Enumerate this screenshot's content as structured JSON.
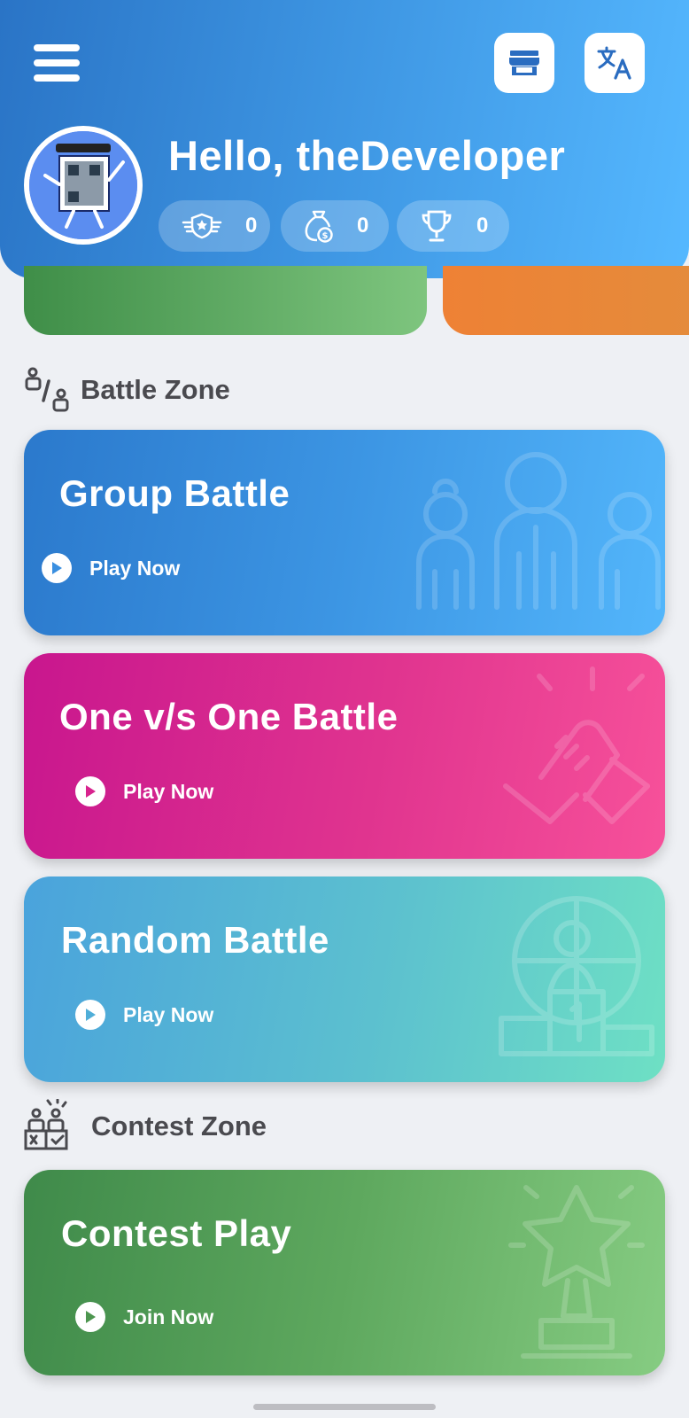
{
  "header": {
    "greeting": "Hello, theDeveloper",
    "stats": [
      {
        "icon": "rank-badge-icon",
        "value": "0"
      },
      {
        "icon": "coin-bag-icon",
        "value": "0"
      },
      {
        "icon": "trophy-icon",
        "value": "0"
      }
    ]
  },
  "battle_zone": {
    "title": "Battle Zone",
    "cards": [
      {
        "title": "Group Battle",
        "action": "Play Now"
      },
      {
        "title": "One v/s One Battle",
        "action": "Play Now"
      },
      {
        "title": "Random Battle",
        "action": "Play Now"
      }
    ]
  },
  "contest_zone": {
    "title": "Contest Zone",
    "cards": [
      {
        "title": "Contest Play",
        "action": "Join Now"
      }
    ]
  },
  "colors": {
    "header_start": "#2a74c6",
    "header_end": "#55b8ff",
    "group_battle": "#3a8fe0",
    "one_vs_one": "#e0348f",
    "random_battle": "#5cc0cf",
    "contest_play": "#5ea85e"
  }
}
